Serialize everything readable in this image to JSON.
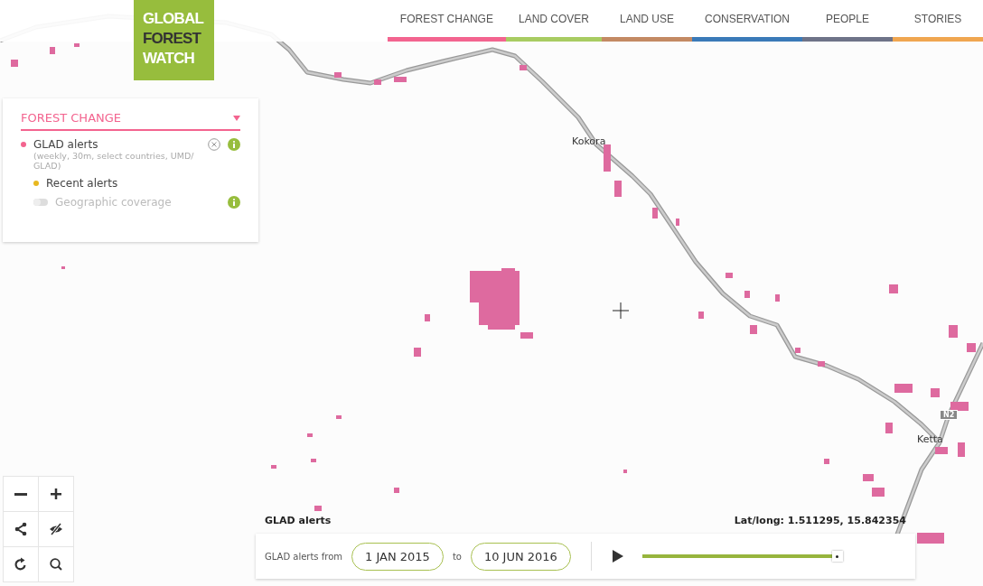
{
  "logo": {
    "lines": [
      "GLOBAL",
      "FOREST",
      "WATCH"
    ]
  },
  "nav": [
    {
      "label": "FOREST CHANGE",
      "color": "#f3648f"
    },
    {
      "label": "LAND COVER",
      "color": "#a8cc62"
    },
    {
      "label": "LAND USE",
      "color": "#c38a63"
    },
    {
      "label": "CONSERVATION",
      "color": "#3a7ab8"
    },
    {
      "label": "PEOPLE",
      "color": "#6e7388"
    },
    {
      "label": "STORIES",
      "color": "#f0a650"
    }
  ],
  "layer_panel": {
    "title": "FOREST CHANGE",
    "layers": [
      {
        "name": "GLAD alerts",
        "color": "#f3648f",
        "description": "(weekly, 30m, select countries, UMD/ GLAD)",
        "sublayers": [
          {
            "name": "Recent alerts",
            "kind": "dot",
            "color": "#e8b820"
          },
          {
            "name": "Geographic coverage",
            "kind": "toggle",
            "on": false
          }
        ]
      }
    ]
  },
  "map_labels": [
    {
      "text": "Kokora",
      "kind": "town"
    },
    {
      "text": "Ketta",
      "kind": "town"
    },
    {
      "text": "N2",
      "kind": "road"
    }
  ],
  "timeline": {
    "title": "GLAD alerts",
    "coordinates": "Lat/long: 1.511295, 15.842354",
    "from_label": "GLAD alerts from",
    "start": "1 JAN 2015",
    "to_label": "to",
    "end": "10 JUN 2016",
    "level": 1
  }
}
